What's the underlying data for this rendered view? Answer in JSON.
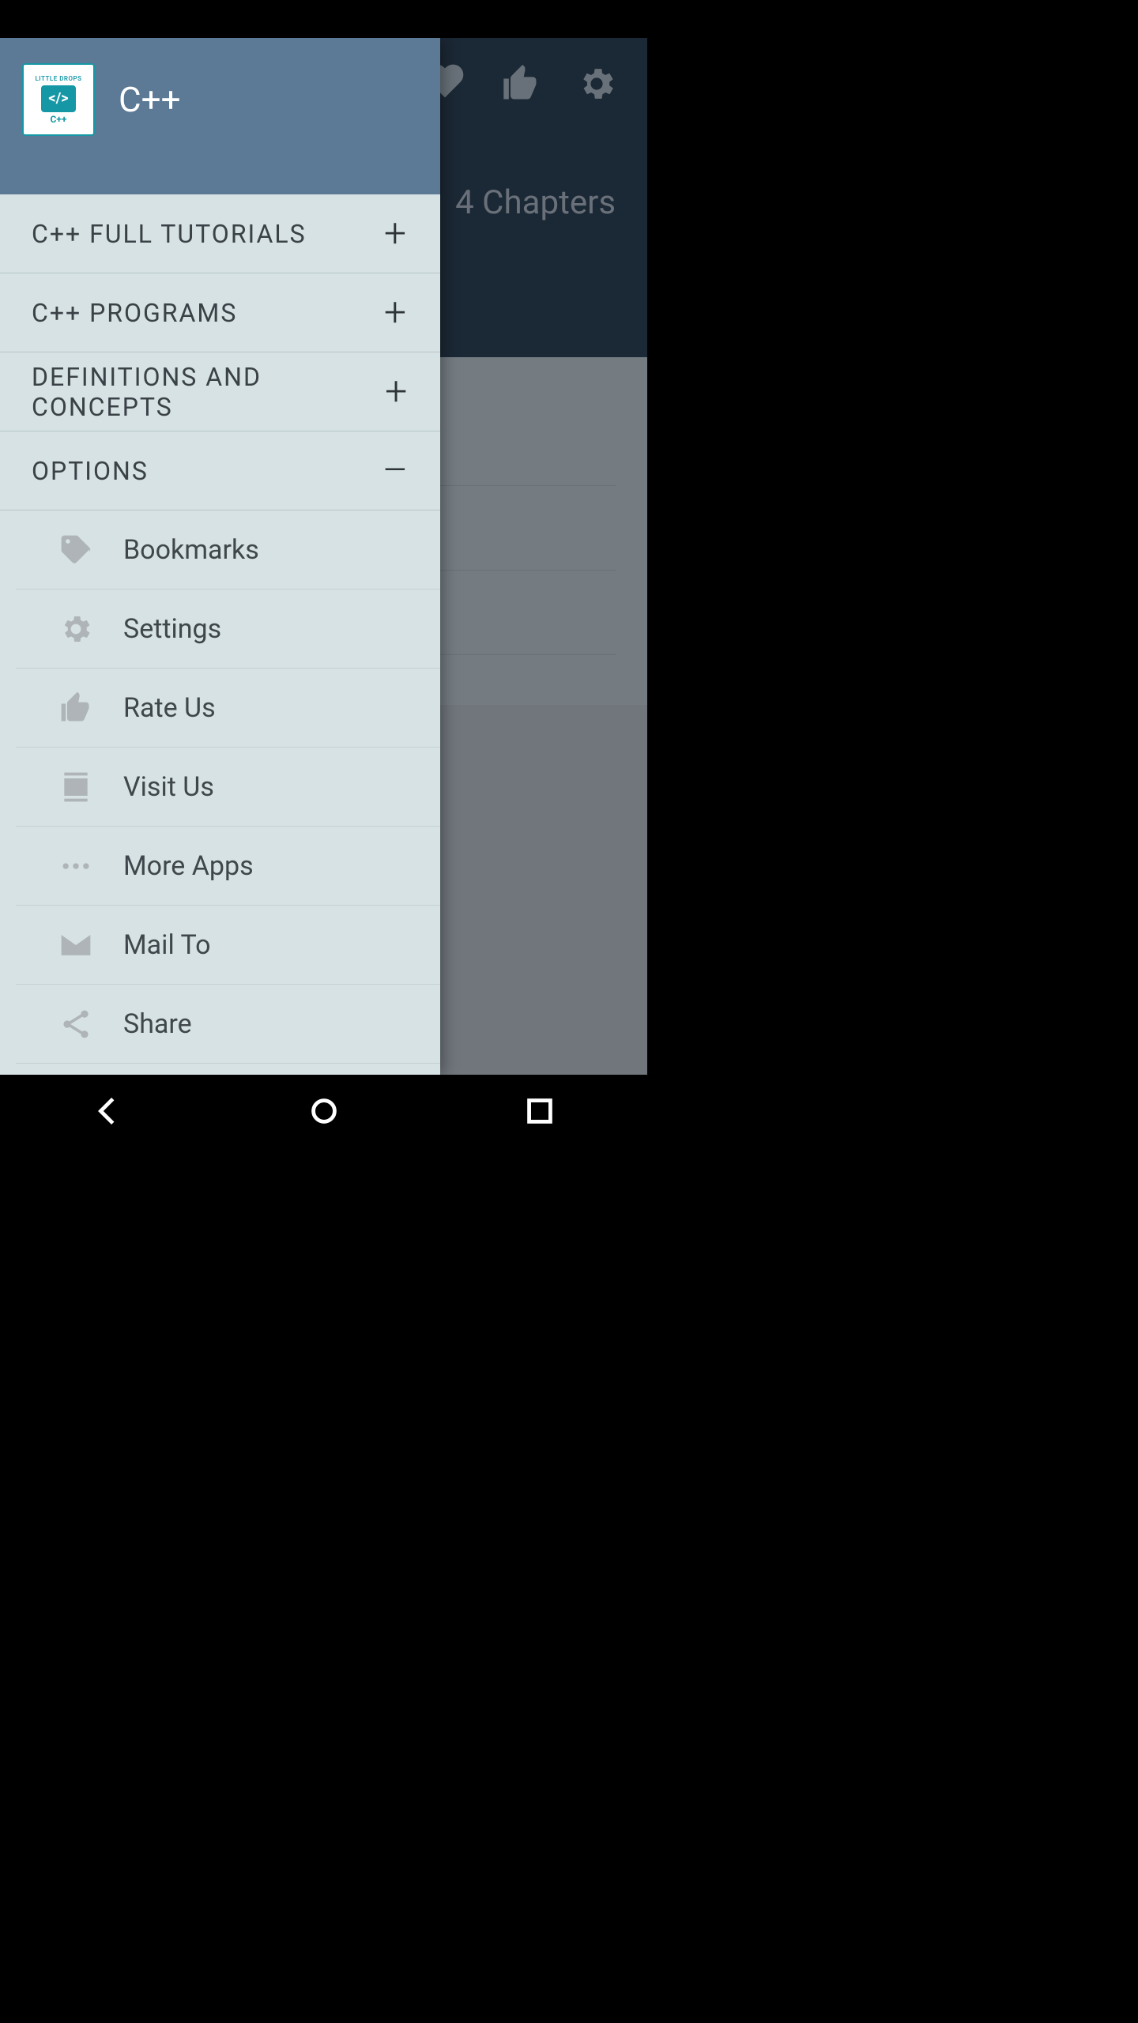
{
  "app": {
    "title": "C++"
  },
  "logo": {
    "top": "LITTLE DROPS",
    "mid": "</>",
    "sub": "C++"
  },
  "background": {
    "chapters_text": "4 Chapters"
  },
  "sections": [
    {
      "label": "C++ FULL TUTORIALS",
      "state": "+",
      "name": "full-tutorials"
    },
    {
      "label": "C++ PROGRAMS",
      "state": "+",
      "name": "programs"
    },
    {
      "label": "DEFINITIONS AND CONCEPTS",
      "state": "+",
      "name": "definitions"
    },
    {
      "label": "OPTIONS",
      "state": "–",
      "name": "options"
    }
  ],
  "options": [
    {
      "label": "Bookmarks",
      "icon": "tag-heart-icon",
      "name": "bookmarks"
    },
    {
      "label": "Settings",
      "icon": "gear-icon",
      "name": "settings"
    },
    {
      "label": "Rate Us",
      "icon": "thumbs-up-icon",
      "name": "rate-us"
    },
    {
      "label": "Visit Us",
      "icon": "contact-icon",
      "name": "visit-us"
    },
    {
      "label": "More Apps",
      "icon": "more-icon",
      "name": "more-apps"
    },
    {
      "label": "Mail To",
      "icon": "mail-icon",
      "name": "mail-to"
    },
    {
      "label": "Share",
      "icon": "share-icon",
      "name": "share"
    }
  ],
  "appbar_actions": [
    {
      "name": "bookmarks-action",
      "icon": "tag-heart-icon"
    },
    {
      "name": "rate-action",
      "icon": "thumbs-up-icon"
    },
    {
      "name": "settings-action",
      "icon": "gear-icon"
    }
  ]
}
